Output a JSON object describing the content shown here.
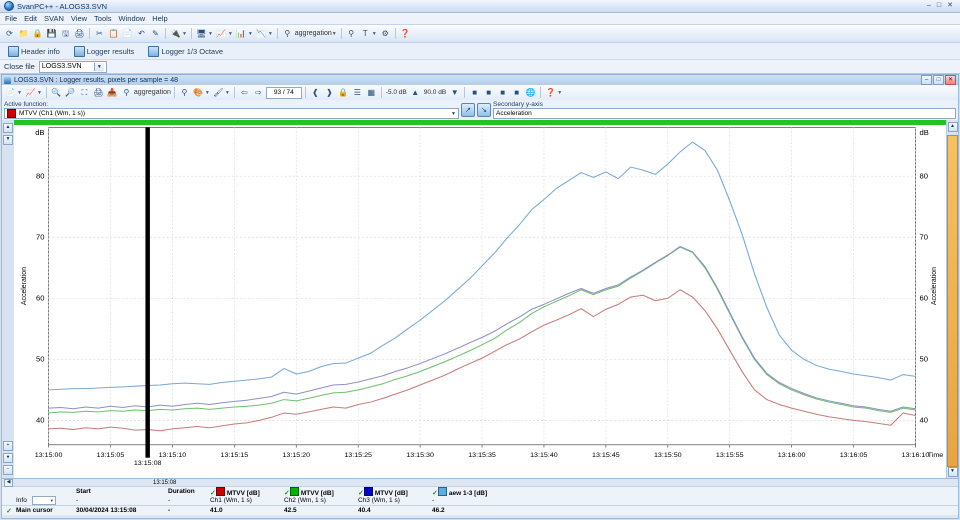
{
  "window": {
    "title": "SvanPC++ - ALOGS3.SVN",
    "minimize": "–",
    "maximize": "□",
    "close": "✕"
  },
  "menu": {
    "items": [
      "File",
      "Edit",
      "SVAN",
      "View",
      "Tools",
      "Window",
      "Help"
    ]
  },
  "toolbar": {
    "aggregation_label": "aggregation",
    "text_tool_label": "T"
  },
  "buttonbar": {
    "items": [
      {
        "label": "Header info",
        "icon": "header-info-icon"
      },
      {
        "label": "Logger results",
        "icon": "logger-results-icon"
      },
      {
        "label": "Logger 1/3 Octave",
        "icon": "logger-third-octave-icon"
      }
    ]
  },
  "filebar": {
    "label": "Close file",
    "value": "LOGS3.SVN"
  },
  "child_window": {
    "title": "LOGS3.SVN : Logger results, pixels per sample = 48",
    "minimize": "–",
    "maximize": "□",
    "close": "✕"
  },
  "child_toolbar": {
    "aggregation_label": "aggregation",
    "sample_field": "93 / 74",
    "level_min": "-5.0 dB",
    "level_max": "90.0 dB"
  },
  "active_function": {
    "caption": "Active function:",
    "value": "MTVV (Ch1 (Wm, 1 s))",
    "swatch": "#cc0000",
    "secondary_caption": "Secondary y-axis",
    "secondary_value": "Acceleration"
  },
  "chart_data": {
    "type": "line",
    "title": "",
    "xlabel": "Time",
    "ylabel": "Acceleration",
    "yunit": "dB",
    "ylim": [
      36,
      88
    ],
    "yticks": [
      40,
      50,
      60,
      70,
      80
    ],
    "grid": true,
    "legend_position": "bottom",
    "xlim": [
      "13:15:00",
      "13:16:10"
    ],
    "xticks": [
      "13:15:00",
      "13:15:05",
      "13:15:10",
      "13:15:15",
      "13:15:20",
      "13:15:25",
      "13:15:30",
      "13:15:35",
      "13:15:40",
      "13:15:45",
      "13:15:50",
      "13:15:55",
      "13:16:00",
      "13:16:05",
      "13:16:10"
    ],
    "cursor": {
      "time": "13:15:08",
      "label": "13:15:08",
      "color": "#000000"
    },
    "x": [
      0,
      1,
      2,
      3,
      4,
      5,
      6,
      7,
      8,
      9,
      10,
      11,
      12,
      13,
      14,
      15,
      16,
      17,
      18,
      19,
      20,
      21,
      22,
      23,
      24,
      25,
      26,
      27,
      28,
      29,
      30,
      31,
      32,
      33,
      34,
      35,
      36,
      37,
      38,
      39,
      40,
      41,
      42,
      43,
      44,
      45,
      46,
      47,
      48,
      49,
      50,
      51,
      52,
      53,
      54,
      55,
      56,
      57,
      58,
      59,
      60,
      61,
      62,
      63,
      64,
      65,
      66,
      67,
      68,
      69,
      70
    ],
    "series": [
      {
        "name": "aew 1-3 [dB]",
        "color": "#7aa8d8",
        "values": [
          45.0,
          45.1,
          45.2,
          45.2,
          45.3,
          45.4,
          45.5,
          45.6,
          45.7,
          45.8,
          46.0,
          46.1,
          46.0,
          45.9,
          46.2,
          46.4,
          46.6,
          46.8,
          47.1,
          48.5,
          47.6,
          48.0,
          48.8,
          49.3,
          49.4,
          50.2,
          51.0,
          52.3,
          53.5,
          55.0,
          56.4,
          58.0,
          59.6,
          61.4,
          63.2,
          65.3,
          67.4,
          69.8,
          72.0,
          74.5,
          76.2,
          78.0,
          79.3,
          80.6,
          79.8,
          80.7,
          79.6,
          81.5,
          81.0,
          80.3,
          82.0,
          84.0,
          85.6,
          84.2,
          81.0,
          76.0,
          70.5,
          64.0,
          58.5,
          54.0,
          51.5,
          50.0,
          49.0,
          48.4,
          48.0,
          47.6,
          47.3,
          47.0,
          46.6,
          47.5,
          47.2
        ]
      },
      {
        "name": "MTVV [dB] Ch3 (Wm, 1 s)",
        "color": "#6fbf6f",
        "values": [
          41.2,
          41.4,
          41.3,
          41.5,
          41.4,
          41.6,
          41.5,
          41.7,
          41.6,
          41.8,
          41.7,
          41.9,
          42.0,
          41.8,
          42.0,
          42.2,
          42.3,
          42.5,
          42.8,
          43.4,
          43.2,
          43.6,
          44.1,
          44.5,
          44.6,
          45.0,
          45.5,
          46.0,
          46.7,
          47.3,
          48.0,
          48.8,
          49.6,
          50.5,
          51.4,
          52.4,
          53.4,
          54.8,
          56.0,
          57.5,
          58.6,
          59.5,
          60.4,
          61.4,
          60.6,
          61.4,
          62.0,
          63.3,
          64.5,
          65.8,
          67.0,
          68.4,
          67.5,
          65.0,
          61.5,
          57.5,
          53.5,
          50.0,
          47.5,
          46.0,
          45.0,
          44.2,
          43.5,
          43.0,
          42.6,
          42.2,
          42.0,
          41.6,
          41.3,
          42.0,
          41.7
        ]
      },
      {
        "name": "MTVV [dB] Ch1 (Wm, 1 s)",
        "color": "#c87a7a",
        "values": [
          38.6,
          38.7,
          38.5,
          38.8,
          38.6,
          38.9,
          38.7,
          38.4,
          38.5,
          38.3,
          38.6,
          38.8,
          39.0,
          38.8,
          39.1,
          39.4,
          39.6,
          40.0,
          40.5,
          41.2,
          41.0,
          41.4,
          41.8,
          42.2,
          42.0,
          42.6,
          43.0,
          43.6,
          44.3,
          45.0,
          45.8,
          46.6,
          47.4,
          48.4,
          49.3,
          50.2,
          51.3,
          52.4,
          53.3,
          54.5,
          55.6,
          56.4,
          57.3,
          58.3,
          57.0,
          58.2,
          59.0,
          60.2,
          60.5,
          59.6,
          60.0,
          61.4,
          60.2,
          58.0,
          55.0,
          51.5,
          48.0,
          45.0,
          43.4,
          42.6,
          42.0,
          41.5,
          41.0,
          40.6,
          40.3,
          40.0,
          39.8,
          39.5,
          39.2,
          41.2,
          40.8
        ]
      },
      {
        "name": "MTVV [dB] Ch2 (Wm, 1 s)",
        "color": "#8f8fc8",
        "values": [
          42.0,
          42.1,
          41.9,
          42.2,
          42.0,
          42.3,
          42.1,
          42.4,
          42.2,
          42.5,
          42.3,
          42.6,
          42.8,
          42.6,
          42.9,
          43.1,
          43.3,
          43.6,
          43.9,
          44.6,
          44.3,
          44.8,
          45.3,
          45.8,
          45.9,
          46.3,
          46.8,
          47.3,
          48.0,
          48.6,
          49.3,
          50.1,
          50.9,
          51.8,
          52.7,
          53.6,
          54.6,
          55.8,
          56.9,
          58.2,
          59.0,
          59.9,
          60.8,
          61.6,
          60.8,
          61.6,
          62.2,
          63.5,
          64.6,
          65.9,
          67.1,
          68.5,
          67.6,
          65.2,
          61.7,
          57.7,
          53.7,
          50.2,
          47.7,
          46.2,
          45.2,
          44.4,
          43.7,
          43.2,
          42.8,
          42.4,
          42.2,
          41.8,
          41.5,
          42.2,
          41.9
        ]
      }
    ]
  },
  "legend_table": {
    "columns": [
      "Start",
      "Duration",
      "MTVV [dB]",
      "MTVV [dB]",
      "MTVV [dB]",
      "aew 1-3 [dB]"
    ],
    "subheaders": [
      "",
      "",
      "Ch1 (Wm, 1 s)",
      "Ch2 (Wm, 1 s)",
      "Ch3 (Wm, 1 s)",
      ""
    ],
    "swatches": [
      "#cc0000",
      "#00b400",
      "#0000cc",
      "#5aaee6"
    ],
    "info_row": {
      "label": "Info",
      "start": "-",
      "duration": "-",
      "values": [
        "",
        "",
        "",
        "-"
      ]
    },
    "cursor_row": {
      "check": "✓",
      "label": "Main cursor",
      "start": "30/04/2024 13:15:08",
      "duration": "-",
      "values": [
        "41.0",
        "42.5",
        "40.4",
        "46.2"
      ]
    }
  },
  "status": {
    "cursor_time": "13:15:08"
  }
}
